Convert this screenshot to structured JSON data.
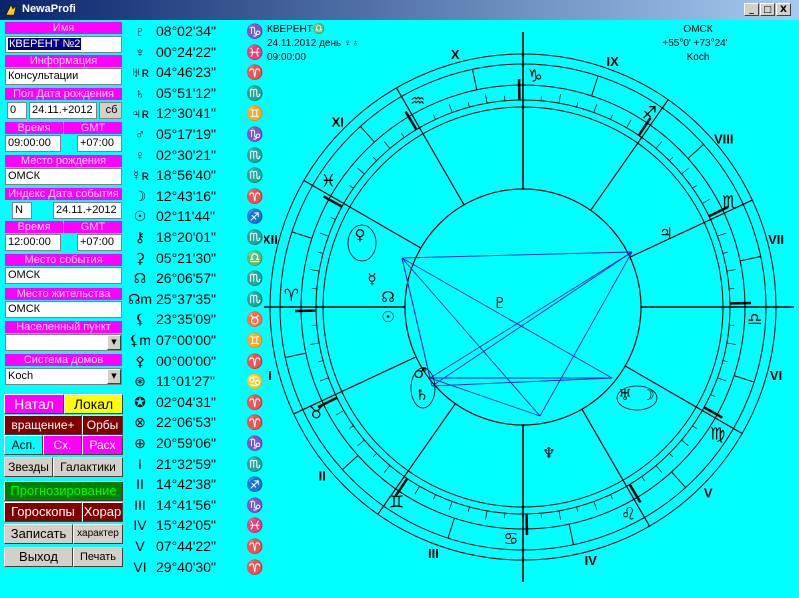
{
  "window": {
    "title": "NewaProfi",
    "minimize": "_",
    "maximize": "□",
    "close": "X"
  },
  "sidebar": {
    "name_label": "Имя",
    "name_value": "КВЕРЕНТ №2",
    "info_label": "Информация",
    "info_value": "Консультации",
    "birth_header": "Пол  Дата рождения",
    "gender": "0",
    "birth_date": "24.11.+2012",
    "weekday": "сб",
    "time_label": "Время",
    "gmt_label": "GMT",
    "birth_time": "09:00:00",
    "birth_gmt": "+07:00",
    "birthplace_label": "Место рождения",
    "birthplace_value": "ОМСК",
    "event_header": "Индекс  Дата события",
    "index_value": "N",
    "event_date": "24.11.+2012",
    "time2_label": "Время",
    "gmt2_label": "GMT",
    "event_time": "12:00:00",
    "event_gmt": "+07:00",
    "event_place_label": "Место события",
    "event_place_value": "ОМСК",
    "residence_label": "Место жительства",
    "residence_value": "ОМСК",
    "settlement_label": "Населенный пункт",
    "settlement_value": "",
    "house_system_label": "Система домов",
    "house_system_value": "Koch"
  },
  "buttons": {
    "natal": "Натал",
    "local": "Локал",
    "rotation": "вращение+",
    "orbs": "Орбы",
    "asp": "Асп.",
    "sx": "Сх.",
    "rasx": "Расх",
    "stars": "Звезды",
    "galaxies": "Галактики",
    "forecast": "Прогнозирование",
    "horoscopes": "Гороскопы",
    "horar": "Хорар",
    "save": "Записать",
    "character": "характер",
    "exit": "Выход",
    "print": "Печать"
  },
  "planets": [
    {
      "sym": "♇",
      "pos": "08°02'34\"",
      "sign": "♑"
    },
    {
      "sym": "♆",
      "pos": "00°24'22\"",
      "sign": "♓"
    },
    {
      "sym": "♅ʀ",
      "pos": "04°46'23\"",
      "sign": "♈"
    },
    {
      "sym": "♄",
      "pos": "05°51'12\"",
      "sign": "♏"
    },
    {
      "sym": "♃ʀ",
      "pos": "12°30'41\"",
      "sign": "♊"
    },
    {
      "sym": "♂",
      "pos": "05°17'19\"",
      "sign": "♑"
    },
    {
      "sym": "♀",
      "pos": "02°30'21\"",
      "sign": "♏"
    },
    {
      "sym": "☿ʀ",
      "pos": "18°56'40\"",
      "sign": "♏"
    },
    {
      "sym": "☽",
      "pos": "12°43'16\"",
      "sign": "♈"
    },
    {
      "sym": "☉",
      "pos": "02°11'44\"",
      "sign": "♐"
    },
    {
      "sym": "⚷",
      "pos": "18°20'01\"",
      "sign": "♏"
    },
    {
      "sym": "⚳",
      "pos": "05°21'30\"",
      "sign": "♎"
    },
    {
      "sym": "☊",
      "pos": "26°06'57\"",
      "sign": "♏"
    },
    {
      "sym": "☊m",
      "pos": "25°37'35\"",
      "sign": "♏"
    },
    {
      "sym": "⚸",
      "pos": "23°35'09\"",
      "sign": "♉"
    },
    {
      "sym": "⚸m",
      "pos": "07°00'00\"",
      "sign": "♊"
    },
    {
      "sym": "⚴",
      "pos": "00°00'00\"",
      "sign": "♈"
    },
    {
      "sym": "⊛",
      "pos": "11°01'27\"",
      "sign": "♋"
    },
    {
      "sym": "✪",
      "pos": "02°04'31\"",
      "sign": "♈"
    },
    {
      "sym": "⊗",
      "pos": "22°06'53\"",
      "sign": "♈"
    },
    {
      "sym": "⊕",
      "pos": "20°59'06\"",
      "sign": "♑"
    },
    {
      "sym": "I",
      "pos": "21°32'59\"",
      "sign": "♏"
    },
    {
      "sym": "II",
      "pos": "14°42'38\"",
      "sign": "♐"
    },
    {
      "sym": "III",
      "pos": "14°41'56\"",
      "sign": "♑"
    },
    {
      "sym": "IV",
      "pos": "15°42'05\"",
      "sign": "♓"
    },
    {
      "sym": "V",
      "pos": "07°44'22\"",
      "sign": "♈"
    },
    {
      "sym": "VI",
      "pos": "29°40'30\"",
      "sign": "♈"
    }
  ],
  "chart": {
    "querent": "КВЕРЕНТ♎",
    "date_line": "24.11.2012 день ♀♁",
    "time": "09:00:00",
    "city": "ОМСК",
    "coords": "+55°0' +73°24'",
    "house_system": "Koch",
    "houses": [
      "I",
      "II",
      "III",
      "IV",
      "V",
      "VI",
      "VII",
      "VIII",
      "IX",
      "X",
      "XI",
      "XII"
    ],
    "signs": [
      "♈",
      "♉",
      "♊",
      "♋",
      "♌",
      "♍",
      "♎",
      "♏",
      "♐",
      "♑",
      "♒",
      "♓"
    ],
    "chart_planets": [
      {
        "sym": "♀",
        "sub": ""
      },
      {
        "sym": "☿",
        "sub": ""
      },
      {
        "sym": "☊",
        "sub": ""
      },
      {
        "sym": "☉",
        "sub": ""
      },
      {
        "sym": "♂",
        "sub": ""
      },
      {
        "sym": "♄",
        "sub": ""
      },
      {
        "sym": "♅",
        "sub": ""
      },
      {
        "sym": "☽",
        "sub": ""
      },
      {
        "sym": "♃",
        "sub": "R"
      },
      {
        "sym": "♆",
        "sub": ""
      },
      {
        "sym": "♇",
        "sub": ""
      }
    ]
  },
  "colors": {
    "background": "#00ffff",
    "label": "#ff00ff",
    "aspect": "#2020c0",
    "natal_bg": "#ff00ff",
    "local_bg": "#ffff00",
    "dark_red": "#800000",
    "green_text": "#00ff00"
  }
}
